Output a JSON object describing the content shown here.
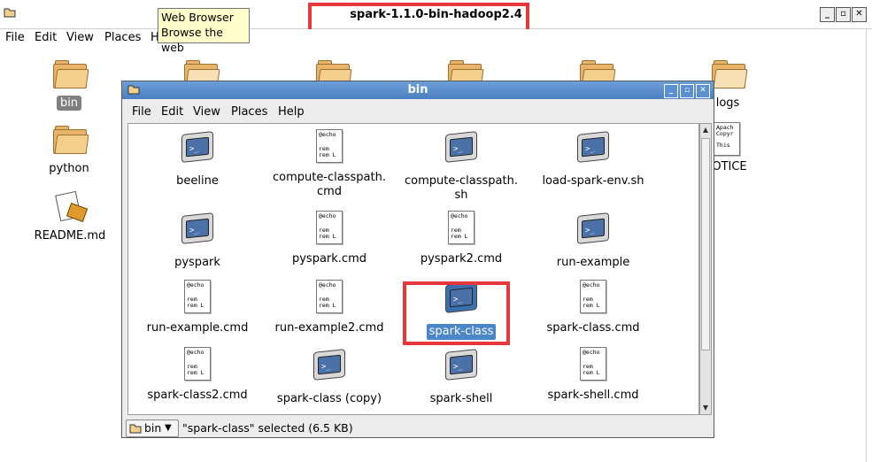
{
  "outer_window": {
    "title": "spark-1.1.0-bin-hadoop2.4",
    "menu": [
      "File",
      "Edit",
      "View",
      "Places",
      "H"
    ],
    "buttons": [
      "_",
      "▫",
      "✕"
    ]
  },
  "tooltip": {
    "line1": "Web Browser",
    "line2": "Browse the web"
  },
  "desktop_icons": [
    {
      "name": "bin",
      "type": "folder"
    },
    {
      "name": "python",
      "type": "folder"
    },
    {
      "name": "README.md",
      "type": "readme"
    },
    {
      "name": "logs",
      "type": "folder"
    },
    {
      "name": "OTICE",
      "type": "document"
    }
  ],
  "inner_window": {
    "title": "bin",
    "menu": [
      "File",
      "Edit",
      "View",
      "Places",
      "Help"
    ],
    "buttons": [
      "_",
      "▫",
      "✕"
    ],
    "files": [
      {
        "name": "beeline",
        "type": "script"
      },
      {
        "name": "compute-classpath.\ncmd",
        "type": "text"
      },
      {
        "name": "compute-classpath.\nsh",
        "type": "script"
      },
      {
        "name": "load-spark-env.sh",
        "type": "script"
      },
      {
        "name": "pyspark",
        "type": "script"
      },
      {
        "name": "pyspark.cmd",
        "type": "text"
      },
      {
        "name": "pyspark2.cmd",
        "type": "text"
      },
      {
        "name": "run-example",
        "type": "script"
      },
      {
        "name": "run-example.cmd",
        "type": "text"
      },
      {
        "name": "run-example2.cmd",
        "type": "text"
      },
      {
        "name": "spark-class",
        "type": "script",
        "selected": true
      },
      {
        "name": "spark-class.cmd",
        "type": "text"
      },
      {
        "name": "spark-class2.cmd",
        "type": "text"
      },
      {
        "name": "spark-class (copy)",
        "type": "script"
      },
      {
        "name": "spark-shell",
        "type": "script"
      },
      {
        "name": "spark-shell.cmd",
        "type": "text"
      }
    ],
    "location_label": "bin",
    "status": "\"spark-class\" selected (6.5 KB)"
  },
  "doc_preview": {
    "l1": "@echo",
    "l2": "rem",
    "l3": "rem L"
  },
  "notice_preview": {
    "l1": "Apach",
    "l2": "Copyr",
    "l3": "This"
  },
  "colors": {
    "highlight": "#e8363b",
    "titlebar": "#4a7fc1",
    "selection": "#4a86c8"
  }
}
